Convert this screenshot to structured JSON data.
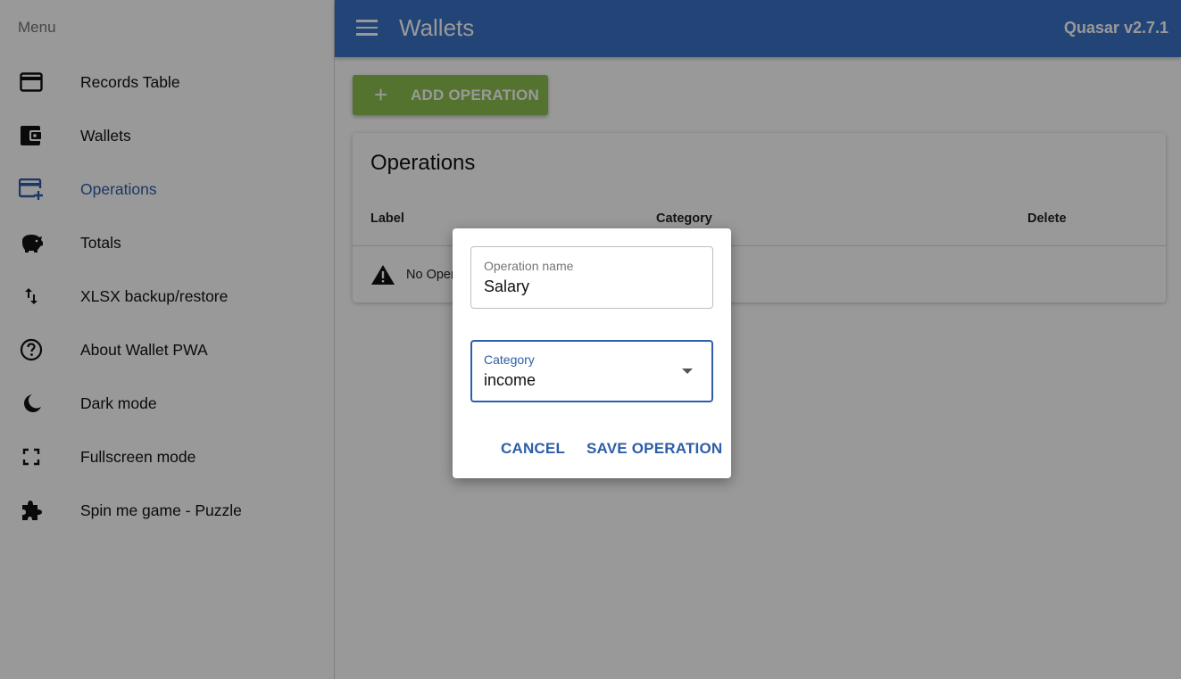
{
  "sidebar": {
    "header": "Menu",
    "items": [
      {
        "label": "Records Table",
        "icon": "credit-card-icon"
      },
      {
        "label": "Wallets",
        "icon": "wallet-icon"
      },
      {
        "label": "Operations",
        "icon": "card-plus-icon",
        "active": true
      },
      {
        "label": "Totals",
        "icon": "piggy-bank-icon"
      },
      {
        "label": "XLSX backup/restore",
        "icon": "swap-vert-icon"
      },
      {
        "label": "About Wallet PWA",
        "icon": "help-circle-icon"
      },
      {
        "label": "Dark mode",
        "icon": "moon-icon"
      },
      {
        "label": "Fullscreen mode",
        "icon": "fullscreen-icon"
      },
      {
        "label": "Spin me game - Puzzle",
        "icon": "puzzle-icon"
      }
    ]
  },
  "header": {
    "title": "Wallets",
    "version": "Quasar v2.7.1"
  },
  "main": {
    "add_button_label": "ADD OPERATION",
    "card": {
      "title": "Operations",
      "columns": [
        "Label",
        "Category",
        "Delete"
      ],
      "no_data_text": "No Oper"
    }
  },
  "dialog": {
    "name_field": {
      "label": "Operation name",
      "value": "Salary"
    },
    "category_field": {
      "label": "Category",
      "value": "income"
    },
    "cancel_label": "CANCEL",
    "save_label": "SAVE OPERATION"
  },
  "colors": {
    "header": "#3a72c7",
    "accent": "#2d5ea8",
    "add_button": "#8bc04f"
  }
}
